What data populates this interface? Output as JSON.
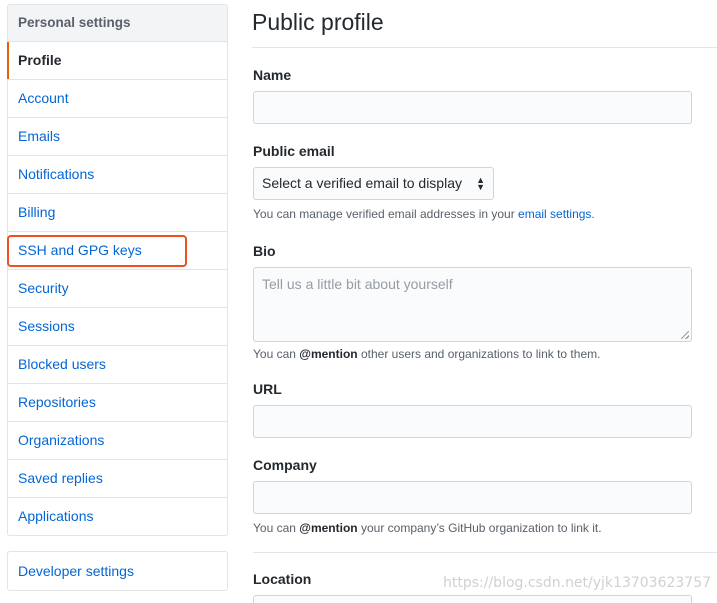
{
  "sidebar": {
    "header": "Personal settings",
    "items": [
      {
        "label": "Profile"
      },
      {
        "label": "Account"
      },
      {
        "label": "Emails"
      },
      {
        "label": "Notifications"
      },
      {
        "label": "Billing"
      },
      {
        "label": "SSH and GPG keys"
      },
      {
        "label": "Security"
      },
      {
        "label": "Sessions"
      },
      {
        "label": "Blocked users"
      },
      {
        "label": "Repositories"
      },
      {
        "label": "Organizations"
      },
      {
        "label": "Saved replies"
      },
      {
        "label": "Applications"
      }
    ],
    "developer_settings": "Developer settings"
  },
  "main": {
    "title": "Public profile",
    "name": {
      "label": "Name",
      "value": ""
    },
    "public_email": {
      "label": "Public email",
      "selected": "Select a verified email to display",
      "note_prefix": "You can manage verified email addresses in your ",
      "note_link": "email settings",
      "note_suffix": "."
    },
    "bio": {
      "label": "Bio",
      "placeholder": "Tell us a little bit about yourself",
      "note_prefix": "You can ",
      "note_mention": "@mention",
      "note_suffix": " other users and organizations to link to them."
    },
    "url": {
      "label": "URL",
      "value": ""
    },
    "company": {
      "label": "Company",
      "value": "",
      "note_prefix": "You can ",
      "note_mention": "@mention",
      "note_suffix": " your company’s GitHub organization to link it."
    },
    "location": {
      "label": "Location"
    }
  },
  "watermark": "https://blog.csdn.net/yjk13703623757",
  "colors": {
    "link": "#0366d6",
    "selected_indicator": "#e36209",
    "highlight_box": "#f04f23"
  }
}
